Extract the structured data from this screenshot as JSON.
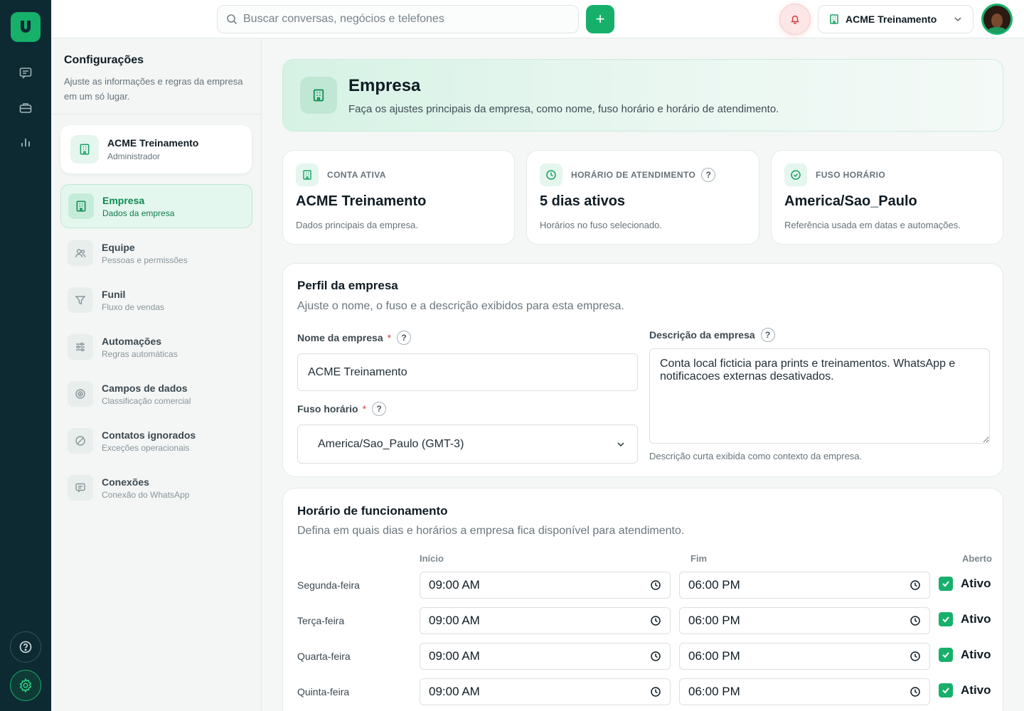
{
  "topbar": {
    "search_placeholder": "Buscar conversas, negócios e telefones",
    "add_label": "+",
    "company": "ACME Treinamento"
  },
  "sidebar": {
    "title": "Configurações",
    "subtitle": "Ajuste as informações e regras da empresa em um só lugar.",
    "account": {
      "name": "ACME Treinamento",
      "role": "Administrador"
    },
    "items": [
      {
        "label": "Empresa",
        "sub": "Dados da empresa",
        "icon": "building-icon",
        "active": true
      },
      {
        "label": "Equipe",
        "sub": "Pessoas e permissões",
        "icon": "users-icon"
      },
      {
        "label": "Funil",
        "sub": "Fluxo de vendas",
        "icon": "funnel-icon"
      },
      {
        "label": "Automações",
        "sub": "Regras automáticas",
        "icon": "sliders-icon"
      },
      {
        "label": "Campos de dados",
        "sub": "Classificação comercial",
        "icon": "target-icon"
      },
      {
        "label": "Contatos ignorados",
        "sub": "Exceções operacionais",
        "icon": "ban-icon"
      },
      {
        "label": "Conexões",
        "sub": "Conexão do WhatsApp",
        "icon": "chat-icon"
      }
    ]
  },
  "hero": {
    "title": "Empresa",
    "subtitle": "Faça os ajustes principais da empresa, como nome, fuso horário e horário de atendimento."
  },
  "stats": [
    {
      "label": "CONTA ATIVA",
      "value": "ACME Treinamento",
      "desc": "Dados principais da empresa."
    },
    {
      "label": "HORÁRIO DE ATENDIMENTO",
      "value": "5 dias ativos",
      "desc": "Horários no fuso selecionado."
    },
    {
      "label": "FUSO HORÁRIO",
      "value": "America/Sao_Paulo",
      "desc": "Referência usada em datas e automações."
    }
  ],
  "profile": {
    "title": "Perfil da empresa",
    "subtitle": "Ajuste o nome, o fuso e a descrição exibidos para esta empresa.",
    "name_label": "Nome da empresa",
    "name_value": "ACME Treinamento",
    "tz_label": "Fuso horário",
    "tz_value": "America/Sao_Paulo (GMT-3)",
    "desc_label": "Descrição da empresa",
    "desc_value": "Conta local ficticia para prints e treinamentos. WhatsApp e notificacoes externas desativados.",
    "desc_hint": "Descrição curta exibida como contexto da empresa.",
    "required_mark": "*",
    "help_mark": "?"
  },
  "hours": {
    "title": "Horário de funcionamento",
    "subtitle": "Defina em quais dias e horários a empresa fica disponível para atendimento.",
    "col_start": "Início",
    "col_end": "Fim",
    "col_open": "Aberto",
    "days": [
      {
        "day": "Segunda-feira",
        "start": "09:00 AM",
        "end": "06:00 PM",
        "status": "Ativo"
      },
      {
        "day": "Terça-feira",
        "start": "09:00 AM",
        "end": "06:00 PM",
        "status": "Ativo"
      },
      {
        "day": "Quarta-feira",
        "start": "09:00 AM",
        "end": "06:00 PM",
        "status": "Ativo"
      },
      {
        "day": "Quinta-feira",
        "start": "09:00 AM",
        "end": "06:00 PM",
        "status": "Ativo"
      }
    ]
  },
  "colors": {
    "accent": "#16b06b",
    "rail": "#0d2a33",
    "danger": "#e03b3b"
  }
}
